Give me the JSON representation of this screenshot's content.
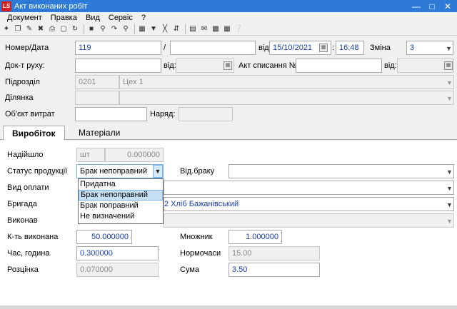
{
  "window": {
    "title": "Акт виконаних робіт",
    "logo_text": "LS"
  },
  "menu": [
    "Документ",
    "Правка",
    "Вид",
    "Сервіс",
    "?"
  ],
  "header": {
    "number_date_label": "Номер/Дата",
    "number_value": "119",
    "slash": "/",
    "from_label": "від",
    "date_value": "15/10/2021",
    "time_value": "16:48",
    "shift_label": "Зміна",
    "shift_value": "3",
    "movement_doc_label": "Док-т руху:",
    "movement_from_label": "від:",
    "writeoff_label": "Акт списання №",
    "writeoff_from_label": "від:",
    "department_label": "Підрозділ",
    "department_code": "0201",
    "department_name": "Цех 1",
    "section_label": "Ділянка",
    "cost_object_label": "Об'єкт витрат",
    "order_label": "Наряд:"
  },
  "tabs": {
    "output": "Виробіток",
    "materials": "Матеріали"
  },
  "output": {
    "received_label": "Надійшло",
    "received_unit": "шт",
    "received_value": "0.000000",
    "status_label": "Статус продукції",
    "status_value": "Брак непоправний",
    "defect_dept_label": "Від.браку",
    "payment_type_label": "Вид оплати",
    "brigade_label": "Бригада",
    "brigade_value": "2 Хліб Бажанівський",
    "performed_label": "Виконав",
    "qty_done_label": "К-ть виконана",
    "qty_done_value": "50.000000",
    "multiplier_label": "Множник",
    "multiplier_value": "1.000000",
    "time_label": "Час, година",
    "time_value": "0.300000",
    "norm_hours_label": "Нормочаси",
    "norm_hours_value": "15.00",
    "rate_label": "Розцінка",
    "rate_value": "0.070000",
    "sum_label": "Сума",
    "sum_value": "3.50"
  },
  "status_options": [
    {
      "label": "Придатна"
    },
    {
      "label": "Брак непоправний"
    },
    {
      "label": "Брак поправний"
    },
    {
      "label": "Не визначений"
    }
  ]
}
